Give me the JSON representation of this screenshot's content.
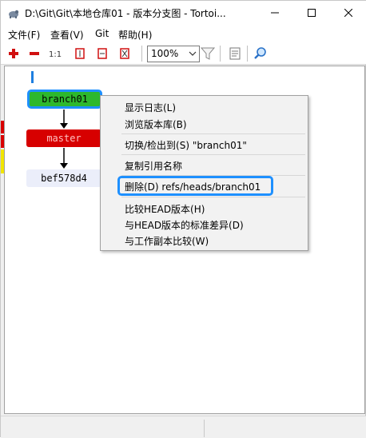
{
  "window": {
    "title": "D:\\Git\\Git\\本地仓库01 - 版本分支图 - Tortoi..."
  },
  "menubar": {
    "items": [
      "文件(F)",
      "查看(V)",
      "Git",
      "帮助(H)"
    ]
  },
  "toolbar": {
    "zoom_value": "100%"
  },
  "graph": {
    "nodes": [
      {
        "label": "branch01",
        "color": "#2db82d"
      },
      {
        "label": "master",
        "color": "#d70000"
      },
      {
        "label": "bef578d4",
        "color": "#ebeefa"
      }
    ]
  },
  "context_menu": {
    "items": [
      "显示日志(L)",
      "浏览版本库(B)",
      "切换/检出到(S) \"branch01\"",
      "复制引用名称",
      "删除(D) refs/heads/branch01",
      "比较HEAD版本(H)",
      "与HEAD版本的标准差异(D)",
      "与工作副本比较(W)"
    ]
  },
  "colors": {
    "highlight": "#1e90ff",
    "branch_local": "#2db82d",
    "branch_current": "#d70000"
  }
}
